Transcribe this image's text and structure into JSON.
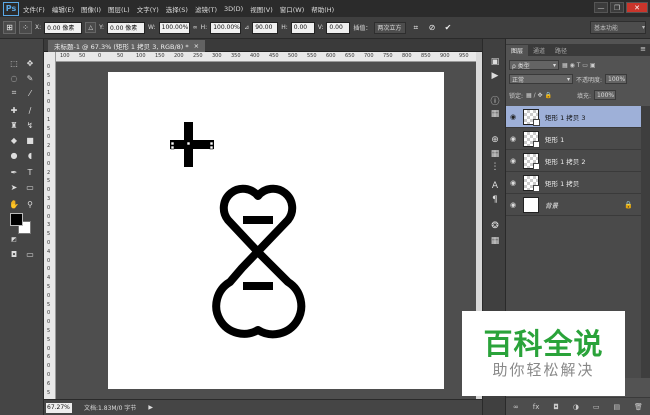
{
  "app": {
    "logo": "Ps"
  },
  "menu": [
    "文件(F)",
    "编辑(E)",
    "图像(I)",
    "图层(L)",
    "文字(Y)",
    "选择(S)",
    "滤镜(T)",
    "3D(D)",
    "视图(V)",
    "窗口(W)",
    "帮助(H)"
  ],
  "window_controls": {
    "minimize": "—",
    "restore": "❐",
    "close": "✕"
  },
  "options": {
    "x_label": "X:",
    "x_value": "0.00 像素",
    "y_label": "Y:",
    "y_value": "0.00 像素",
    "w_label": "W:",
    "w_value": "100.00%",
    "h_label": "H:",
    "h_value": "100.00%",
    "angle_value": "90.00",
    "hskew_label": "H:",
    "hskew_value": "0.00",
    "v_label": "V:",
    "v_value": "0.00",
    "interp_label": "插值：",
    "interp_value": "两次立方",
    "workspace": "基本功能"
  },
  "document": {
    "tab_title": "未标题-1 @ 67.3% (矩形 1 拷贝 3, RGB/8) *",
    "tab_close": "×",
    "ruler_h": [
      "100",
      "50",
      "0",
      "50",
      "100",
      "150",
      "200",
      "250",
      "300",
      "350",
      "400",
      "450",
      "500",
      "550",
      "600",
      "650",
      "700",
      "750",
      "800",
      "850",
      "900",
      "950"
    ],
    "ruler_v": [
      "0",
      "5",
      "0",
      "1",
      "0",
      "0",
      "1",
      "5",
      "0",
      "2",
      "0",
      "0",
      "2",
      "5",
      "0",
      "3",
      "0",
      "0",
      "3",
      "5",
      "0",
      "4",
      "0",
      "0",
      "4",
      "5",
      "0",
      "5",
      "0",
      "0",
      "5",
      "5",
      "0",
      "6",
      "0",
      "0",
      "6",
      "5"
    ]
  },
  "status": {
    "zoom": "67.27%",
    "doc_info": "文档:1.83M/0 字节",
    "arrow": "▶"
  },
  "panel": {
    "tabs": [
      "图层",
      "通道",
      "路径"
    ],
    "kind_label": "ρ 类型",
    "blend_mode": "正常",
    "opacity_label": "不透明度:",
    "opacity_value": "100%",
    "lock_label": "锁定:",
    "fill_label": "填充:",
    "fill_value": "100%",
    "layers": [
      {
        "name": "矩形 1 拷贝 3",
        "selected": true
      },
      {
        "name": "矩形 1",
        "selected": false
      },
      {
        "name": "矩形 1 拷贝 2",
        "selected": false
      },
      {
        "name": "矩形 1 拷贝",
        "selected": false
      },
      {
        "name": "背景",
        "selected": false
      }
    ],
    "bottom_icons": [
      "∞",
      "fx",
      "◘",
      "◑",
      "▭",
      "▤",
      "🗑"
    ]
  },
  "watermark": {
    "main": "百科全说",
    "sub": "助你轻松解决"
  },
  "colors": {
    "menubar": "#2b2b2b",
    "panel": "#535353",
    "selected_layer": "#9eb0d8",
    "watermark_green": "#2aa33a"
  }
}
